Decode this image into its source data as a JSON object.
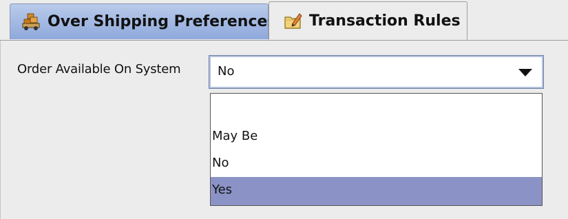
{
  "tabs": [
    {
      "label": "Over Shipping Preferences",
      "icon": "truck-boxes-icon",
      "selected": false
    },
    {
      "label": "Transaction Rules",
      "icon": "folder-edit-icon",
      "selected": true
    }
  ],
  "form": {
    "field_label": "Order Available On System",
    "combo_value": "No",
    "options": [
      "",
      "May Be",
      "No",
      "Yes"
    ],
    "highlighted_option": "Yes"
  },
  "colors": {
    "highlight": "#8b93c6",
    "inactive_tab": "#a6bbe4",
    "background": "#ececec"
  }
}
